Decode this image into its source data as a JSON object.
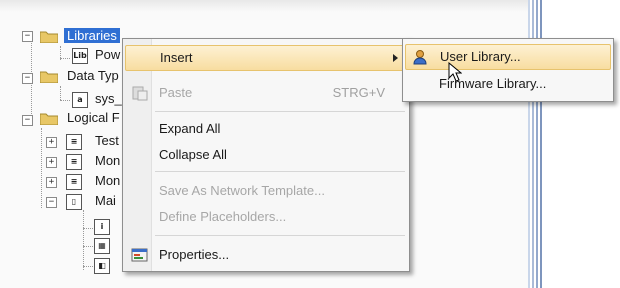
{
  "tree": {
    "nodes": [
      {
        "label": "Libraries",
        "selected": true
      },
      {
        "label": "Pow"
      },
      {
        "label": "Data Typ"
      },
      {
        "label": "sys_"
      },
      {
        "label": "Logical F"
      },
      {
        "label": "Test"
      },
      {
        "label": "Mon"
      },
      {
        "label": "Mon"
      },
      {
        "label": "Mai"
      }
    ]
  },
  "context_menu": {
    "items": [
      {
        "label": "Insert",
        "has_submenu": true,
        "highlighted": true
      },
      {
        "label": "Paste",
        "shortcut": "STRG+V",
        "disabled": true
      },
      {
        "label": "Expand All"
      },
      {
        "label": "Collapse All"
      },
      {
        "label": "Save As Network Template...",
        "disabled": true
      },
      {
        "label": "Define Placeholders...",
        "disabled": true
      },
      {
        "label": "Properties..."
      }
    ]
  },
  "submenu": {
    "items": [
      {
        "label": "User Library...",
        "highlighted": true
      },
      {
        "label": "Firmware Library..."
      }
    ]
  },
  "icons": {
    "folder": "folder-icon",
    "paste": "paste-icon",
    "properties": "properties-icon",
    "user_library": "user-library-icon",
    "cursor": "mouse-cursor-icon"
  },
  "colors": {
    "selection": "#2f6fd3",
    "menu_highlight": "#f8dda0",
    "menu_highlight_border": "#e7c36d",
    "disabled_text": "#a7a7a7"
  }
}
